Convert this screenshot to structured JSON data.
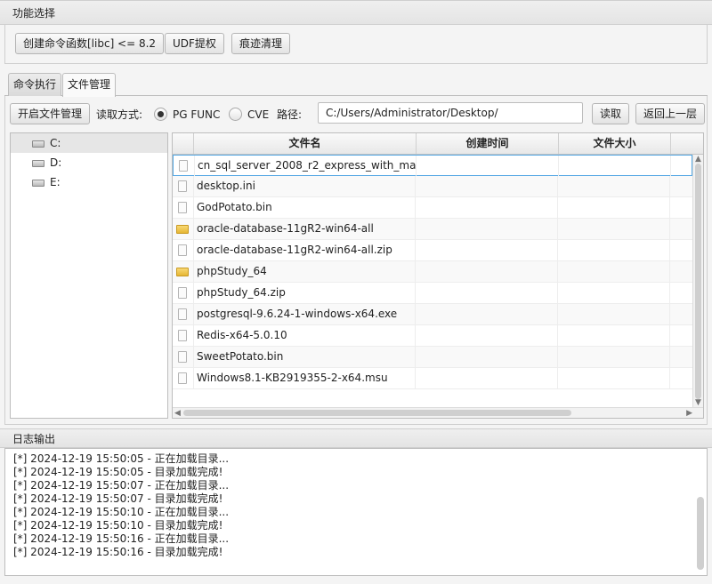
{
  "function_panel": {
    "title": "功能选择",
    "buttons": [
      "创建命令函数[libc] <= 8.2",
      "UDF提权",
      "痕迹清理"
    ]
  },
  "tabs": [
    {
      "label": "命令执行",
      "active": false
    },
    {
      "label": "文件管理",
      "active": true
    }
  ],
  "file_manager": {
    "open_button": "开启文件管理",
    "read_mode_label": "读取方式:",
    "read_modes": [
      {
        "label": "PG FUNC",
        "selected": true
      },
      {
        "label": "CVE",
        "selected": false
      }
    ],
    "path_label": "路径:",
    "path_value": "C:/Users/Administrator/Desktop/",
    "read_button": "读取",
    "back_button": "返回上一层",
    "drives": [
      {
        "label": "C:",
        "selected": true
      },
      {
        "label": "D:",
        "selected": false
      },
      {
        "label": "E:",
        "selected": false
      }
    ],
    "columns": [
      "文件名",
      "创建时间",
      "文件大小"
    ],
    "files": [
      {
        "name": "cn_sql_server_2008_r2_express_with_ma...",
        "type": "file",
        "icon": "file-icon"
      },
      {
        "name": "desktop.ini",
        "type": "file",
        "icon": "file-icon"
      },
      {
        "name": "GodPotato.bin",
        "type": "file",
        "icon": "file-icon"
      },
      {
        "name": "oracle-database-11gR2-win64-all",
        "type": "folder",
        "icon": "folder-icon"
      },
      {
        "name": "oracle-database-11gR2-win64-all.zip",
        "type": "file",
        "icon": "file-icon"
      },
      {
        "name": "phpStudy_64",
        "type": "folder",
        "icon": "folder-icon"
      },
      {
        "name": "phpStudy_64.zip",
        "type": "file",
        "icon": "file-icon"
      },
      {
        "name": "postgresql-9.6.24-1-windows-x64.exe",
        "type": "file",
        "icon": "file-icon"
      },
      {
        "name": "Redis-x64-5.0.10",
        "type": "file",
        "icon": "file-icon"
      },
      {
        "name": "SweetPotato.bin",
        "type": "file",
        "icon": "file-icon"
      },
      {
        "name": "Windows8.1-KB2919355-2-x64.msu",
        "type": "file",
        "icon": "file-icon"
      }
    ]
  },
  "log_panel": {
    "title": "日志输出",
    "lines": [
      "[*] 2024-12-19 15:50:05 - 正在加载目录...",
      "[*] 2024-12-19 15:50:05 - 目录加载完成!",
      "[*] 2024-12-19 15:50:07 - 正在加载目录...",
      "[*] 2024-12-19 15:50:07 - 目录加载完成!",
      "[*] 2024-12-19 15:50:10 - 正在加载目录...",
      "[*] 2024-12-19 15:50:10 - 目录加载完成!",
      "[*] 2024-12-19 15:50:16 - 正在加载目录...",
      "[*] 2024-12-19 15:50:16 - 目录加载完成!"
    ]
  },
  "colors": {
    "focus_border": "#55a8e4",
    "folder": "#e6b733"
  }
}
